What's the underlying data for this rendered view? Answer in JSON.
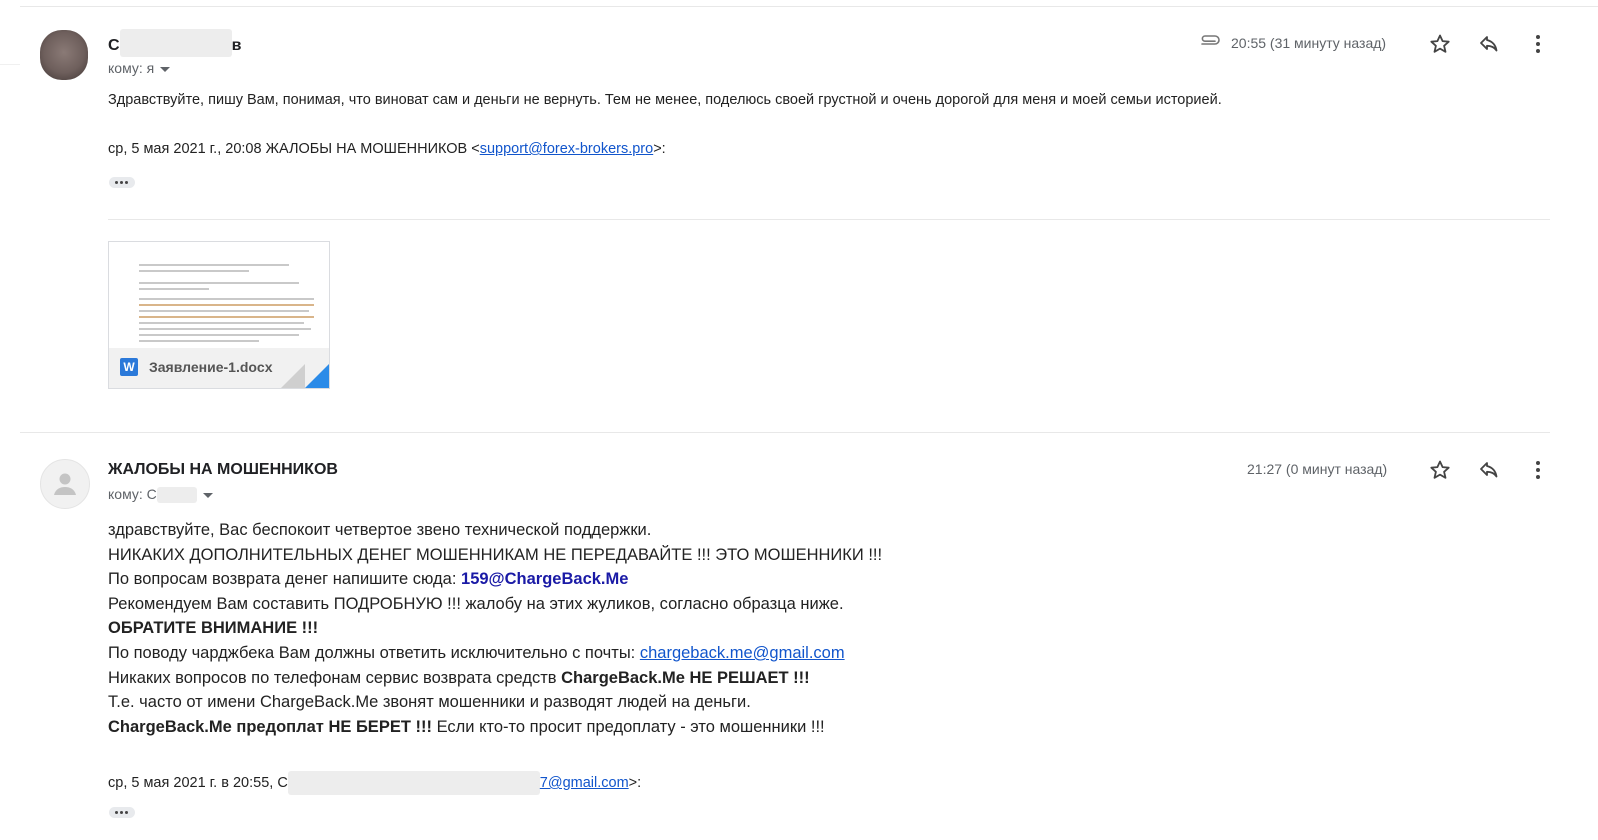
{
  "message1": {
    "sender_prefix": "С",
    "sender_suffix": "в",
    "to_label": "кому: я",
    "time": "20:55 (31 минуту назад)",
    "body": "Здравствуйте, пишу Вам, понимая, что виноват сам и деньги не вернуть. Тем не менее, поделюсь своей грустной и очень дорогой для меня и моей семьи историей.",
    "quote_prefix": "ср, 5 мая 2021 г., 20:08 ЖАЛОБЫ НА МОШЕННИКОВ <",
    "quote_email": "support@forex-brokers.pro",
    "quote_suffix": ">:",
    "attachment_name": "Заявление-1.docx",
    "attachment_icon": "W"
  },
  "message2": {
    "sender": "ЖАЛОБЫ НА МОШЕННИКОВ",
    "to_label": "кому: С",
    "time": "21:27 (0 минут назад)",
    "lines": {
      "l1": "здравствуйте, Вас беспокоит четвертое звено технической поддержки.",
      "l2": "НИКАКИХ ДОПОЛНИТЕЛЬНЫХ ДЕНЕГ МОШЕННИКАМ НЕ ПЕРЕДАВАЙТЕ !!! ЭТО МОШЕННИКИ !!!",
      "l3_prefix": "По вопросам возврата денег напишите сюда: ",
      "l3_email": "159@ChargeBack.Me",
      "l4": "Рекомендуем Вам составить ПОДРОБНУЮ !!! жалобу на этих жуликов, согласно образца ниже.",
      "l5": "ОБРАТИТЕ ВНИМАНИЕ !!!",
      "l6_prefix": "По поводу чарджбека Вам должны ответить исключительно с почты: ",
      "l6_email": "chargeback.me@gmail.com",
      "l7_prefix": "Никаких вопросов по телефонам сервис возврата средств ",
      "l7_bold": "ChargeBack.Me НЕ РЕШАЕТ !!!",
      "l8": "Т.е. часто от имени ChargeBack.Me звонят мошенники и разводят людей на деньги.",
      "l9_bold": "ChargeBack.Me предоплат НЕ БЕРЕТ !!!",
      "l9_suffix": " Если кто-то просит предоплату - это мошенники !!!"
    },
    "quote_prefix": "ср, 5 мая 2021 г. в 20:55, С",
    "quote_email": "7@gmail.com",
    "quote_suffix": ">:"
  },
  "icons": [
    "paperclip-icon",
    "star-icon",
    "reply-icon",
    "more-vert-icon",
    "person-icon",
    "word-doc-icon"
  ]
}
